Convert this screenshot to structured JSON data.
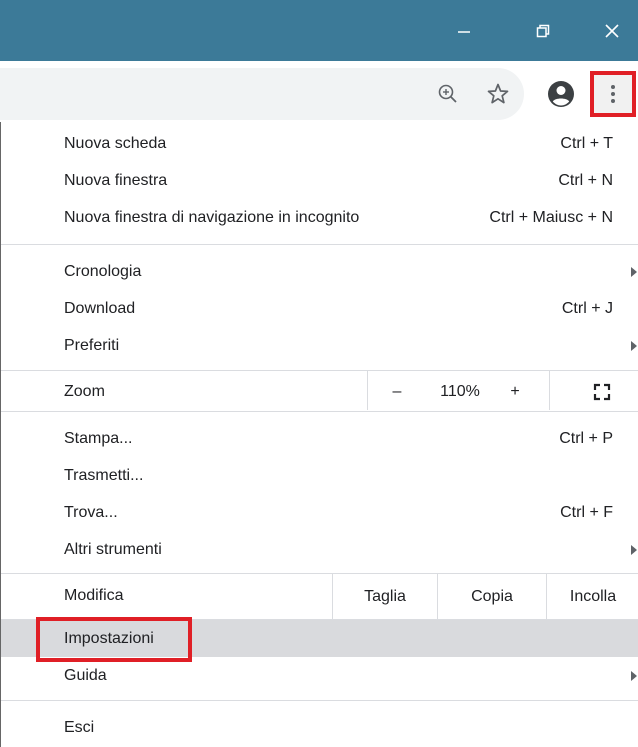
{
  "window": {
    "minimize_icon": "minimize-icon",
    "maximize_icon": "restore-icon",
    "close_icon": "close-icon",
    "titlebar_color": "#3c7a98"
  },
  "toolbar": {
    "icons": [
      "zoom-in-icon",
      "star-icon",
      "account-icon",
      "more-vert-icon"
    ]
  },
  "menu": {
    "new_tab": {
      "label": "Nuova scheda",
      "shortcut": "Ctrl + T"
    },
    "new_window": {
      "label": "Nuova finestra",
      "shortcut": "Ctrl + N"
    },
    "incognito": {
      "label": "Nuova finestra di navigazione in incognito",
      "shortcut": "Ctrl + Maiusc + N"
    },
    "history": {
      "label": "Cronologia"
    },
    "downloads": {
      "label": "Download",
      "shortcut": "Ctrl + J"
    },
    "bookmarks": {
      "label": "Preferiti"
    },
    "zoom": {
      "label": "Zoom",
      "minus": "–",
      "level": "110%",
      "plus": "+"
    },
    "print": {
      "label": "Stampa...",
      "shortcut": "Ctrl + P"
    },
    "cast": {
      "label": "Trasmetti..."
    },
    "find": {
      "label": "Trova...",
      "shortcut": "Ctrl + F"
    },
    "more_tools": {
      "label": "Altri strumenti"
    },
    "edit": {
      "label": "Modifica",
      "cut": "Taglia",
      "copy": "Copia",
      "paste": "Incolla"
    },
    "settings": {
      "label": "Impostazioni"
    },
    "help": {
      "label": "Guida"
    },
    "exit": {
      "label": "Esci"
    }
  },
  "annotation_color": "#e01f26"
}
